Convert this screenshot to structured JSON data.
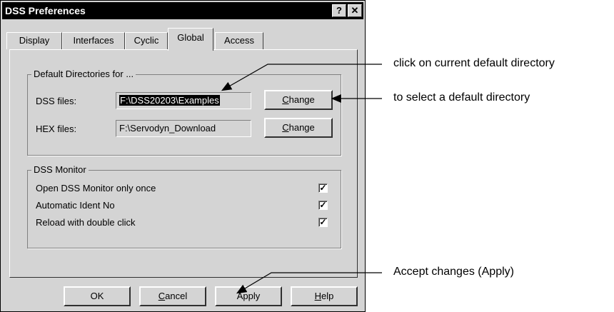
{
  "window": {
    "title": "DSS Preferences",
    "help_glyph": "?",
    "close_glyph": "✕"
  },
  "tabs": [
    {
      "label": "Display"
    },
    {
      "label": "Interfaces"
    },
    {
      "label": "Cyclic"
    },
    {
      "label": "Global",
      "active": true
    },
    {
      "label": "Access"
    }
  ],
  "directories": {
    "group_label": "Default Directories for ...",
    "dss_label": "DSS files:",
    "dss_value": "F:\\DSS20203\\Examples",
    "hex_label": "HEX files:",
    "hex_value": "F:\\Servodyn_Download",
    "change_first": "C",
    "change_rest": "hange"
  },
  "monitor": {
    "group_label": "DSS Monitor",
    "options": [
      {
        "label": "Open DSS Monitor only once",
        "checked": true
      },
      {
        "label": "Automatic Ident No",
        "checked": true
      },
      {
        "label": "Reload with double click",
        "checked": true
      }
    ],
    "check_glyph": "✓"
  },
  "buttons": {
    "ok": "OK",
    "cancel_first": "C",
    "cancel_rest": "ancel",
    "apply": "Apply",
    "help_first": "H",
    "help_rest": "elp"
  },
  "annotations": {
    "dir_click": "click on current default directory",
    "dir_select": "to select a default directory",
    "apply": "Accept changes (Apply)"
  }
}
